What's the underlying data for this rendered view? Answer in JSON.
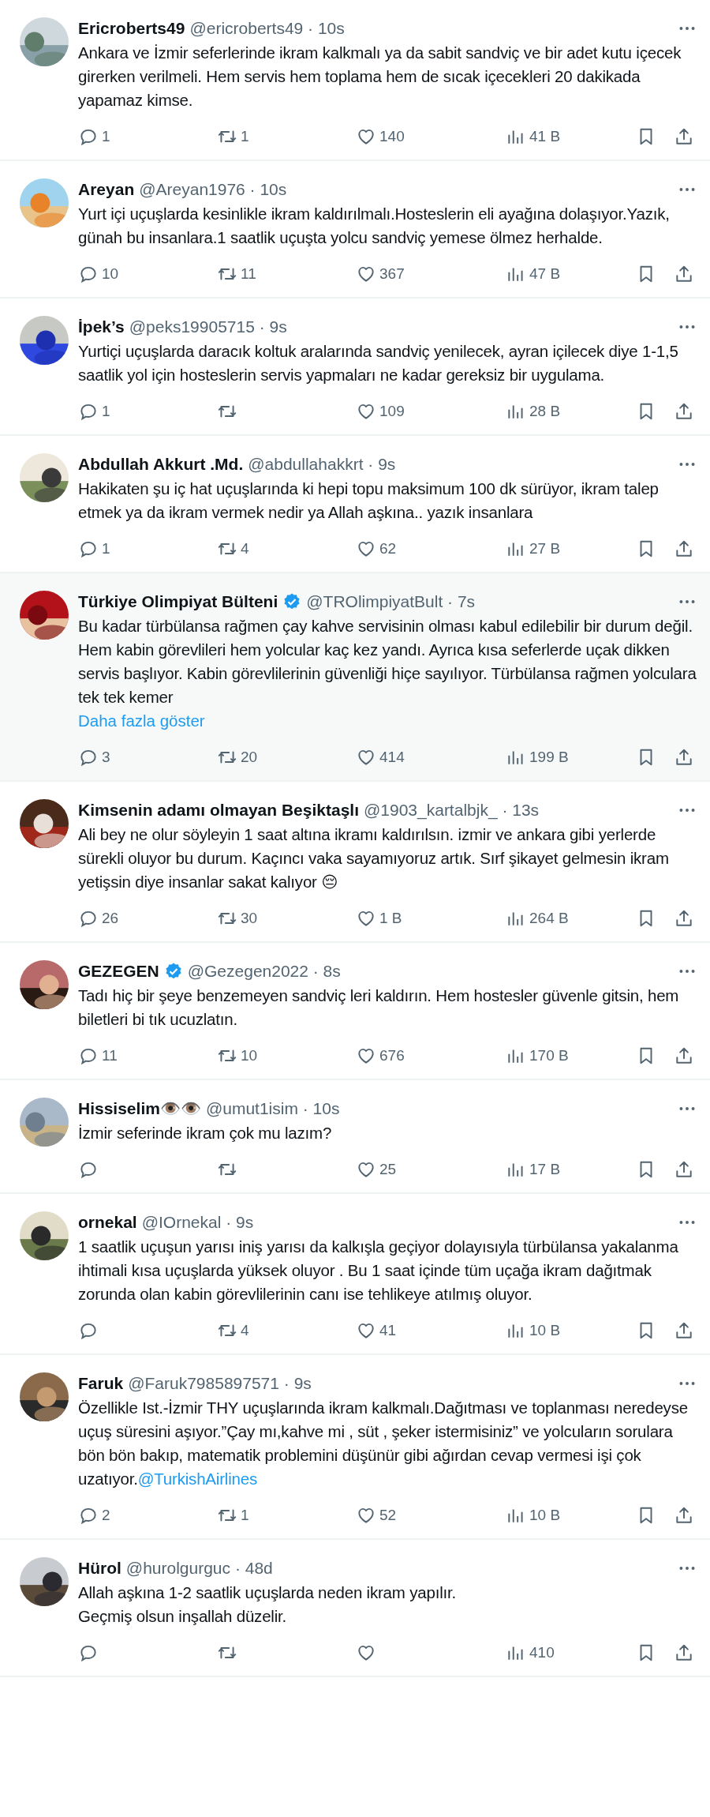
{
  "tweets": [
    {
      "name": "Ericroberts49",
      "verified": false,
      "meta": "@ericroberts49 · 10s",
      "highlighted": false,
      "text": "Ankara ve İzmir seferlerinde ikram kalkmalı ya da sabit sandviç ve bir adet kutu içecek girerken verilmeli. Hem servis hem toplama hem de sıcak içecekleri 20 dakikada yapamaz kimse.",
      "stats": {
        "replies": "1",
        "retweets": "1",
        "likes": "140",
        "views": "41 B"
      }
    },
    {
      "name": "Areyan",
      "verified": false,
      "meta": "@Areyan1976 · 10s",
      "highlighted": false,
      "text": "Yurt içi uçuşlarda kesinlikle ikram kaldırılmalı.Hosteslerin eli ayağına dolaşıyor.Yazık, günah bu insanlara.1 saatlik uçuşta yolcu sandviç yemese ölmez herhalde.",
      "stats": {
        "replies": "10",
        "retweets": "11",
        "likes": "367",
        "views": "47 B"
      }
    },
    {
      "name": "İpek’s",
      "verified": false,
      "meta": "@peks19905715 · 9s",
      "highlighted": false,
      "text": "Yurtiçi uçuşlarda daracık koltuk aralarında sandviç yenilecek, ayran içilecek diye 1-1,5 saatlik yol için hosteslerin servis yapmaları ne kadar gereksiz bir uygulama.",
      "stats": {
        "replies": "1",
        "likes": "109",
        "views": "28 B"
      }
    },
    {
      "name": "Abdullah Akkurt .Md.",
      "verified": false,
      "meta": "@abdullahakkrt · 9s",
      "highlighted": false,
      "text": "Hakikaten şu iç hat uçuşlarında ki hepi topu maksimum 100 dk sürüyor, ikram talep etmek ya da ikram vermek nedir ya Allah aşkına.. yazık insanlara",
      "stats": {
        "replies": "1",
        "retweets": "4",
        "likes": "62",
        "views": "27 B"
      }
    },
    {
      "name": "Türkiye Olimpiyat Bülteni",
      "verified": true,
      "meta": "@TROlimpiyatBult · 7s",
      "highlighted": true,
      "text": "Bu kadar türbülansa rağmen çay kahve servisinin olması kabul edilebilir bir durum değil. Hem kabin görevlileri hem yolcular kaç kez yandı. Ayrıca kısa seferlerde uçak dikken servis başlıyor. Kabin görevlilerinin güvenliği hiçe sayılıyor. Türbülansa rağmen yolculara tek tek kemer",
      "show_more": "Daha fazla göster",
      "stats": {
        "replies": "3",
        "retweets": "20",
        "likes": "414",
        "views": "199 B"
      }
    },
    {
      "name": "Kimsenin adamı olmayan Beşiktaşlı",
      "verified": false,
      "meta": "@1903_kartalbjk_ · 13s",
      "highlighted": false,
      "text": "Ali bey ne olur söyleyin 1 saat altına ikramı kaldırılsın. izmir ve ankara gibi yerlerde sürekli oluyor bu durum. Kaçıncı vaka sayamıyoruz artık. Sırf şikayet gelmesin ikram yetişsin diye insanlar sakat kalıyor 😔",
      "stats": {
        "replies": "26",
        "retweets": "30",
        "likes": "1 B",
        "views": "264 B"
      }
    },
    {
      "name": "GEZEGEN",
      "verified": true,
      "meta": "@Gezegen2022 · 8s",
      "highlighted": false,
      "text": "Tadı hiç bir şeye benzemeyen sandviç leri kaldırın. Hem hostesler güvenle gitsin, hem biletleri bi tık ucuzlatın.",
      "stats": {
        "replies": "11",
        "retweets": "10",
        "likes": "676",
        "views": "170 B"
      }
    },
    {
      "name": "Hissiselim👁️👁️",
      "verified": false,
      "meta": "@umut1isim · 10s",
      "highlighted": false,
      "text": "İzmir seferinde ikram çok mu lazım?",
      "stats": {
        "likes": "25",
        "views": "17 B"
      }
    },
    {
      "name": "ornekal",
      "verified": false,
      "meta": "@IOrnekal · 9s",
      "highlighted": false,
      "text": "1 saatlik uçuşun yarısı iniş yarısı da kalkışla geçiyor dolayısıyla türbülansa yakalanma ihtimali kısa uçuşlarda yüksek oluyor . Bu 1 saat içinde tüm uçağa ikram dağıtmak zorunda olan kabin görevlilerinin canı ise tehlikeye atılmış oluyor.",
      "stats": {
        "retweets": "4",
        "likes": "41",
        "views": "10 B"
      }
    },
    {
      "name": "Faruk",
      "verified": false,
      "meta": "@Faruk7985897571 · 9s",
      "highlighted": false,
      "text": "Özellikle Ist.-İzmir THY uçuşlarında ikram kalkmalı.Dağıtması ve toplanması neredeyse uçuş süresini aşıyor.”Çay mı,kahve mi , süt , şeker istermisiniz” ve yolcuların sorulara bön bön bakıp, matematik problemini düşünür gibi ağırdan cevap vermesi işi çok uzatıyor.",
      "mention": "@TurkishAirlines",
      "stats": {
        "replies": "2",
        "retweets": "1",
        "likes": "52",
        "views": "10 B"
      }
    },
    {
      "name": "Hürol",
      "verified": false,
      "meta": "@hurolgurguc · 48d",
      "highlighted": false,
      "text": "Allah aşkına 1-2 saatlik uçuşlarda neden ikram yapılır.\nGeçmiş olsun inşallah düzelir.",
      "stats": {
        "views": "410"
      }
    }
  ]
}
